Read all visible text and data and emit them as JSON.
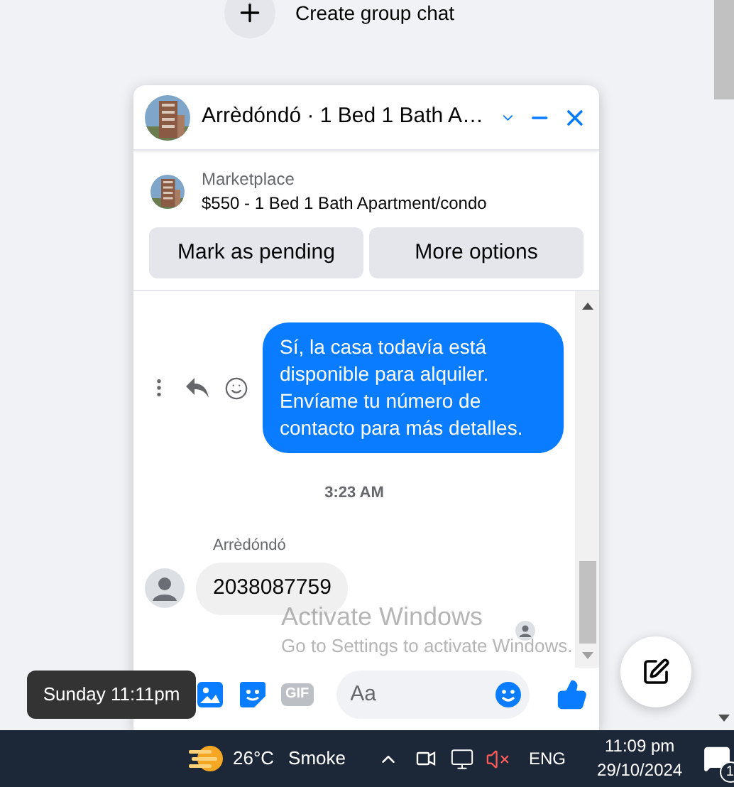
{
  "page": {
    "create_group_chat": "Create group chat"
  },
  "chat": {
    "title": "Arrèdóndó · 1 Bed 1 Bath A…",
    "listing": {
      "source": "Marketplace",
      "summary": "$550 - 1 Bed 1 Bath Apartment/condo"
    },
    "actions": [
      "Mark as pending",
      "More options"
    ],
    "messages": [
      {
        "kind": "outgoing",
        "text": "Sí, la casa todavía está disponible para alquiler. Envíame tu número de contacto para más detalles."
      },
      {
        "kind": "timestamp",
        "text": "3:23 AM"
      },
      {
        "kind": "incoming",
        "sender": "Arrèdóndó",
        "text": "2038087759"
      }
    ],
    "composer": {
      "gif_label": "GIF",
      "placeholder": "Aa"
    }
  },
  "tooltip": "Sunday 11:11pm",
  "activation_notice": {
    "title": "Activate Windows",
    "subtitle": "Go to Settings to activate Windows."
  },
  "taskbar": {
    "temperature": "26°C",
    "weather": "Smoke",
    "language": "ENG",
    "time": "11:09 pm",
    "date": "29/10/2024",
    "notification_count": "1"
  }
}
